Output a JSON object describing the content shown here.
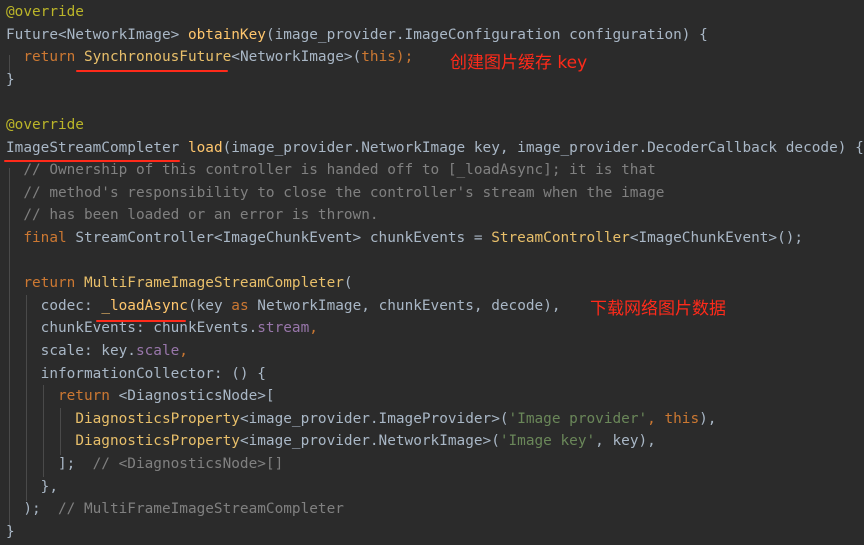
{
  "annotations": {
    "cache_key": "创建图片缓存 key",
    "download": "下载网络图片数据"
  },
  "code_lines": [
    [
      {
        "t": "@override",
        "c": "t-ann"
      }
    ],
    [
      {
        "t": "Future<NetworkImage> ",
        "c": "t-pl"
      },
      {
        "t": "obtainKey",
        "c": "t-fn"
      },
      {
        "t": "(image_provider.ImageConfiguration configuration) {",
        "c": "t-pl"
      }
    ],
    [
      {
        "t": "  ",
        "c": "t-pl"
      },
      {
        "t": "return ",
        "c": "t-kw"
      },
      {
        "t": "SynchronousFuture",
        "c": "t-cls"
      },
      {
        "t": "<NetworkImage>(",
        "c": "t-pl"
      },
      {
        "t": "this",
        "c": "t-kw"
      },
      {
        "t": ");",
        "c": "t-kw"
      }
    ],
    [
      {
        "t": "}",
        "c": "t-pl"
      }
    ],
    [],
    [
      {
        "t": "@override",
        "c": "t-ann"
      }
    ],
    [
      {
        "t": "ImageStreamCompleter ",
        "c": "t-pl"
      },
      {
        "t": "load",
        "c": "t-fn"
      },
      {
        "t": "(image_provider.NetworkImage key, image_provider.DecoderCallback decode) {",
        "c": "t-pl"
      }
    ],
    [
      {
        "t": "  // Ownership of this controller is handed off to [_loadAsync]; it is that",
        "c": "t-cmt"
      }
    ],
    [
      {
        "t": "  // method's responsibility to close the controller's stream when the image",
        "c": "t-cmt"
      }
    ],
    [
      {
        "t": "  // has been loaded or an error is thrown.",
        "c": "t-cmt"
      }
    ],
    [
      {
        "t": "  ",
        "c": "t-pl"
      },
      {
        "t": "final ",
        "c": "t-kw"
      },
      {
        "t": "StreamController<ImageChunkEvent> chunkEvents = ",
        "c": "t-pl"
      },
      {
        "t": "StreamController",
        "c": "t-cls"
      },
      {
        "t": "<ImageChunkEvent>();",
        "c": "t-pl"
      }
    ],
    [],
    [
      {
        "t": "  ",
        "c": "t-pl"
      },
      {
        "t": "return ",
        "c": "t-kw"
      },
      {
        "t": "MultiFrameImageStreamCompleter",
        "c": "t-cls"
      },
      {
        "t": "(",
        "c": "t-pl"
      }
    ],
    [
      {
        "t": "    codec: ",
        "c": "t-pl"
      },
      {
        "t": "_loadAsync",
        "c": "t-fn"
      },
      {
        "t": "(key ",
        "c": "t-pl"
      },
      {
        "t": "as ",
        "c": "t-kw"
      },
      {
        "t": "NetworkImage, chunkEvents, decode),",
        "c": "t-pl"
      }
    ],
    [
      {
        "t": "    chunkEvents: chunkEvents.",
        "c": "t-pl"
      },
      {
        "t": "stream",
        "c": "t-field"
      },
      {
        "t": ",",
        "c": "t-kw"
      }
    ],
    [
      {
        "t": "    scale: key.",
        "c": "t-pl"
      },
      {
        "t": "scale",
        "c": "t-field"
      },
      {
        "t": ",",
        "c": "t-kw"
      }
    ],
    [
      {
        "t": "    informationCollector: () {",
        "c": "t-pl"
      }
    ],
    [
      {
        "t": "      ",
        "c": "t-pl"
      },
      {
        "t": "return ",
        "c": "t-kw"
      },
      {
        "t": "<DiagnosticsNode>[",
        "c": "t-pl"
      }
    ],
    [
      {
        "t": "        ",
        "c": "t-pl"
      },
      {
        "t": "DiagnosticsProperty",
        "c": "t-cls"
      },
      {
        "t": "<image_provider.ImageProvider>(",
        "c": "t-pl"
      },
      {
        "t": "'Image provider'",
        "c": "t-str"
      },
      {
        "t": ", ",
        "c": "t-kw"
      },
      {
        "t": "this",
        "c": "t-kw"
      },
      {
        "t": "),",
        "c": "t-pl"
      }
    ],
    [
      {
        "t": "        ",
        "c": "t-pl"
      },
      {
        "t": "DiagnosticsProperty",
        "c": "t-cls"
      },
      {
        "t": "<image_provider.NetworkImage>(",
        "c": "t-pl"
      },
      {
        "t": "'Image key'",
        "c": "t-str"
      },
      {
        "t": ", key),",
        "c": "t-pl"
      }
    ],
    [
      {
        "t": "      ];  ",
        "c": "t-pl"
      },
      {
        "t": "// <DiagnosticsNode>[]",
        "c": "t-cmt"
      }
    ],
    [
      {
        "t": "    },",
        "c": "t-pl"
      }
    ],
    [
      {
        "t": "  );  ",
        "c": "t-pl"
      },
      {
        "t": "// MultiFrameImageStreamCompleter",
        "c": "t-cmt"
      }
    ],
    [
      {
        "t": "}",
        "c": "t-pl"
      }
    ]
  ]
}
